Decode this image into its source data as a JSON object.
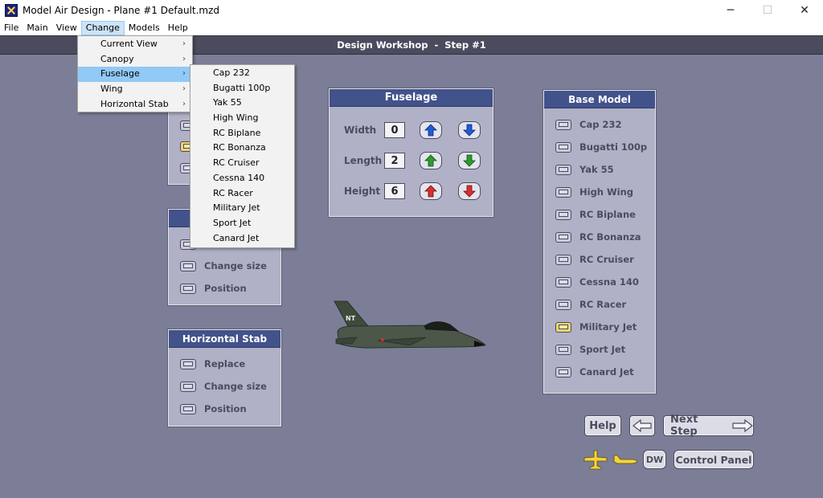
{
  "window": {
    "title": "Model Air Design - Plane #1  Default.mzd",
    "minimize": "─",
    "maximize": "☐",
    "close": "✕"
  },
  "menubar": [
    "File",
    "Main",
    "View",
    "Change",
    "Models",
    "Help"
  ],
  "header": {
    "title": "Design Workshop  -  Step #1"
  },
  "change_menu": {
    "items": [
      "Current View",
      "Canopy",
      "Fuselage",
      "Wing",
      "Horizontal Stab"
    ],
    "highlighted": "Fuselage"
  },
  "fuselage_submenu": {
    "items": [
      "Cap 232",
      "Bugatti 100p",
      "Yak 55",
      "High Wing",
      "RC Biplane",
      "RC Bonanza",
      "RC Cruiser",
      "Cessna 140",
      "RC Racer",
      "Military Jet",
      "Sport Jet",
      "Canard Jet"
    ]
  },
  "fuselage_panel": {
    "title": "Fuselage",
    "rows": [
      {
        "label": "Width",
        "value": "0",
        "up_color": "#1e5bd6",
        "down_color": "#1e5bd6"
      },
      {
        "label": "Length",
        "value": "2",
        "up_color": "#2f9a2f",
        "down_color": "#2f9a2f"
      },
      {
        "label": "Height",
        "value": "6",
        "up_color": "#d63030",
        "down_color": "#d63030"
      }
    ]
  },
  "wing_panel": {
    "items": [
      "Change size",
      "Position"
    ]
  },
  "hstab_panel": {
    "title": "Horizontal Stab",
    "items": [
      "Replace",
      "Change size",
      "Position"
    ]
  },
  "base_model_panel": {
    "title": "Base Model",
    "items": [
      "Cap 232",
      "Bugatti 100p",
      "Yak 55",
      "High Wing",
      "RC Biplane",
      "RC Bonanza",
      "RC Cruiser",
      "Cessna 140",
      "RC Racer",
      "Military Jet",
      "Sport Jet",
      "Canard Jet"
    ],
    "selected": "Military Jet"
  },
  "aircraft": {
    "tail_text": "NT"
  },
  "buttons": {
    "help": "Help",
    "next_step": "Next Step",
    "dw": "DW",
    "control_panel": "Control Panel"
  },
  "colors": {
    "accent": "#42528a",
    "background": "#7c7e97",
    "selected": "#f2d56d"
  }
}
